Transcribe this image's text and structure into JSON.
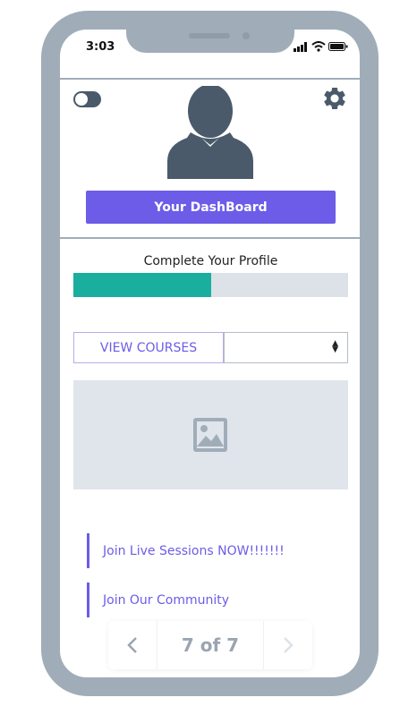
{
  "status_bar": {
    "time": "3:03",
    "icons": [
      "signal-icon",
      "wifi-icon",
      "battery-icon"
    ]
  },
  "header": {
    "toggle_on": false
  },
  "dashboard": {
    "button_label": "Your DashBoard"
  },
  "profile": {
    "label": "Complete Your Profile",
    "progress": 0.5
  },
  "courses": {
    "button_label": "VIEW COURSES",
    "select_value": ""
  },
  "links": [
    {
      "label": "Join Live Sessions NOW!!!!!!!"
    },
    {
      "label": "Join Our Community"
    }
  ],
  "pager": {
    "label": "7 of 7"
  },
  "colors": {
    "accent": "#6c5ce7",
    "progress_fill": "#1aae9f",
    "frame": "#a0adb9",
    "icon_dark": "#4a5a6a"
  }
}
